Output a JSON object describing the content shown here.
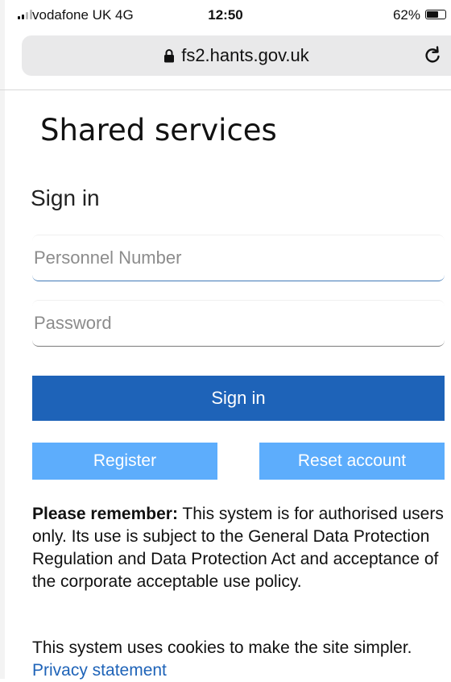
{
  "status_bar": {
    "carrier": "vodafone UK  4G",
    "time": "12:50",
    "battery_percent": "62%",
    "battery_level": 0.62
  },
  "browser": {
    "url": "fs2.hants.gov.uk",
    "icons": [
      "lock-icon",
      "reload-icon"
    ]
  },
  "page": {
    "title": "Shared services",
    "signin_heading": "Sign in",
    "personnel_placeholder": "Personnel Number",
    "personnel_value": "",
    "password_placeholder": "Password",
    "password_value": "",
    "signin_button": "Sign in",
    "register_button": "Register",
    "reset_button": "Reset account",
    "notice_label": "Please remember:",
    "notice_text": " This system is for authorised users only. Its use is subject to the General Data Protection Regulation and Data Protection Act and acceptance of the corporate acceptable use policy.",
    "cookies_text": "This system uses cookies to make the site simpler.",
    "privacy_link": "Privacy statement"
  },
  "colors": {
    "primary_button": "#1e63b8",
    "secondary_button": "#5dadfc",
    "link": "#1e63b8",
    "focus_underline": "#3f79b6"
  }
}
